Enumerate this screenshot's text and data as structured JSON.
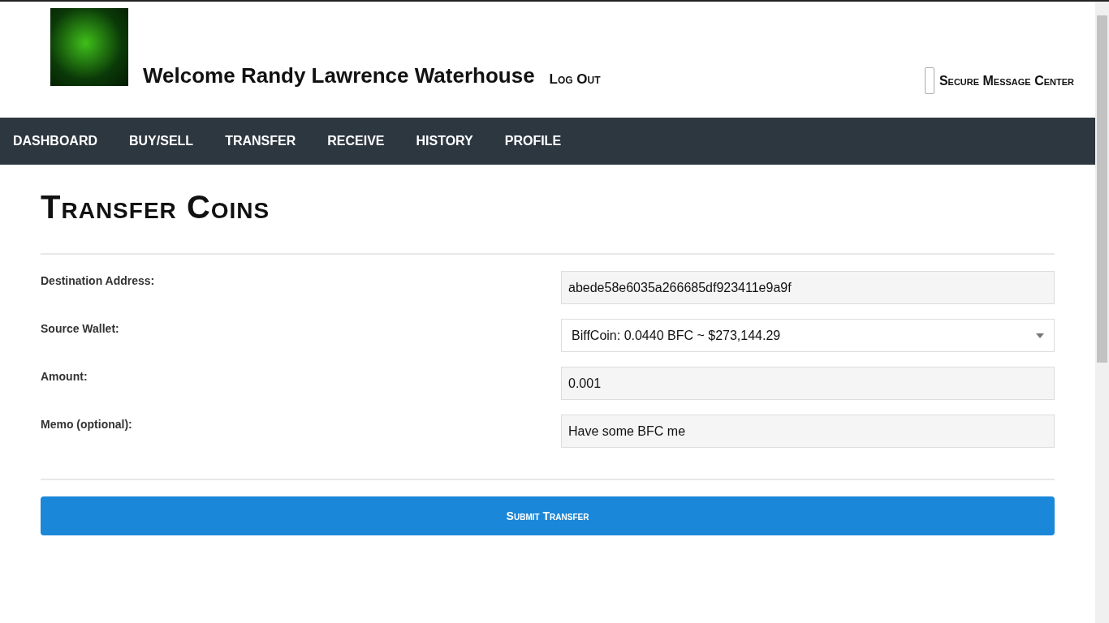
{
  "header": {
    "welcome": "Welcome Randy Lawrence Waterhouse",
    "logout": "Log Out",
    "message_center": "Secure Message Center"
  },
  "nav": [
    {
      "label": "DASHBOARD",
      "selected": false
    },
    {
      "label": "BUY/SELL",
      "selected": false
    },
    {
      "label": "TRANSFER",
      "selected": false
    },
    {
      "label": "RECEIVE",
      "selected": false
    },
    {
      "label": "HISTORY",
      "selected": false
    },
    {
      "label": "PROFILE",
      "selected": false
    }
  ],
  "title": "Transfer Coins",
  "fields": [
    {
      "kind": "text",
      "label": "Destination Address:",
      "value": "abede58e6035a266685df923411e9a9f"
    },
    {
      "kind": "select",
      "label": "Source Wallet:",
      "value": "BiffCoin: 0.0440 BFC ~ $273,144.29"
    },
    {
      "kind": "text",
      "label": "Amount:",
      "value": "0.001"
    },
    {
      "kind": "text",
      "label": "Memo (optional):",
      "value": "Have some BFC me"
    }
  ],
  "submit": "Submit Transfer"
}
